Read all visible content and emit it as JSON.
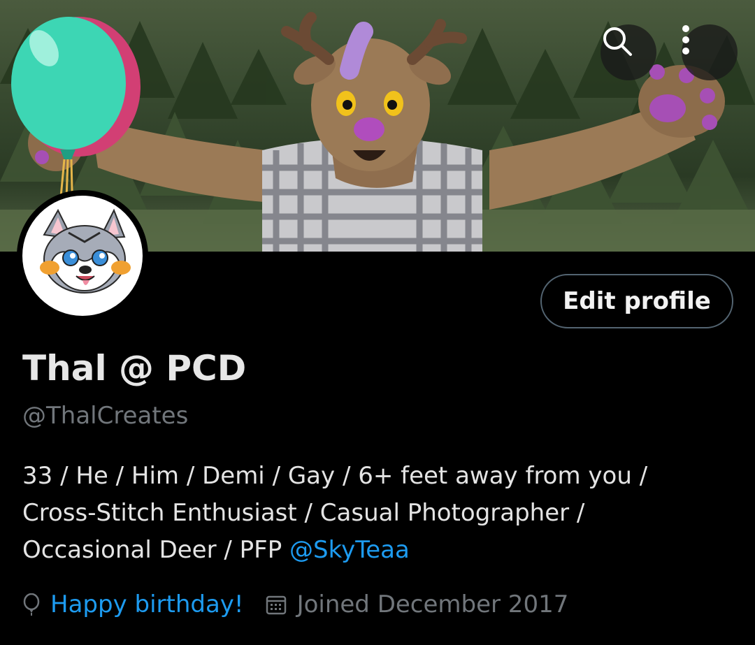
{
  "header": {
    "search_icon": "search-icon",
    "more_icon": "more-vertical-icon",
    "birthday_balloon_icon": "balloon-icon"
  },
  "profile": {
    "display_name": "Thal @ PCD",
    "handle": "@ThalCreates",
    "edit_button_label": "Edit profile",
    "bio_lines": [
      "33 / He / Him / Demi / Gay / 6+ feet away from you /",
      "Cross-Stitch Enthusiast / Casual Photographer /",
      "Occasional Deer / PFP "
    ],
    "bio_mention": "@SkyTeaa"
  },
  "meta": {
    "birthday_icon": "balloon-outline-icon",
    "birthday_text": "Happy birthday!",
    "joined_icon": "calendar-icon",
    "joined_text": "Joined December 2017"
  },
  "colors": {
    "background": "#000000",
    "accent_link": "#1d9bf0",
    "muted_text": "#71767b",
    "button_border": "#536471"
  }
}
